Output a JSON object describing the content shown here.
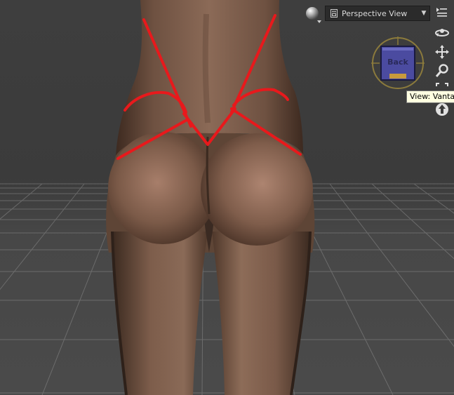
{
  "viewport": {
    "camera_label": "Perspective View",
    "tooltip": "View: Vantage",
    "view_cube_face": "Back"
  },
  "icons": {
    "sphere": "display-style-sphere-icon",
    "camera": "camera-icon",
    "chevron": "chevron-down-icon",
    "menu": "viewport-menu-icon",
    "orbit": "orbit-icon",
    "pan": "pan-icon",
    "zoom": "zoom-icon",
    "frame": "frame-icon",
    "reset": "reset-view-icon"
  },
  "colors": {
    "header_bg": "#2b2b2b",
    "header_text": "#dcdcdc",
    "cube_face": "#4b4ba0",
    "cube_accent": "#c89a3c",
    "tooltip_bg": "#ffffe1",
    "annotation": "#e8191c"
  }
}
